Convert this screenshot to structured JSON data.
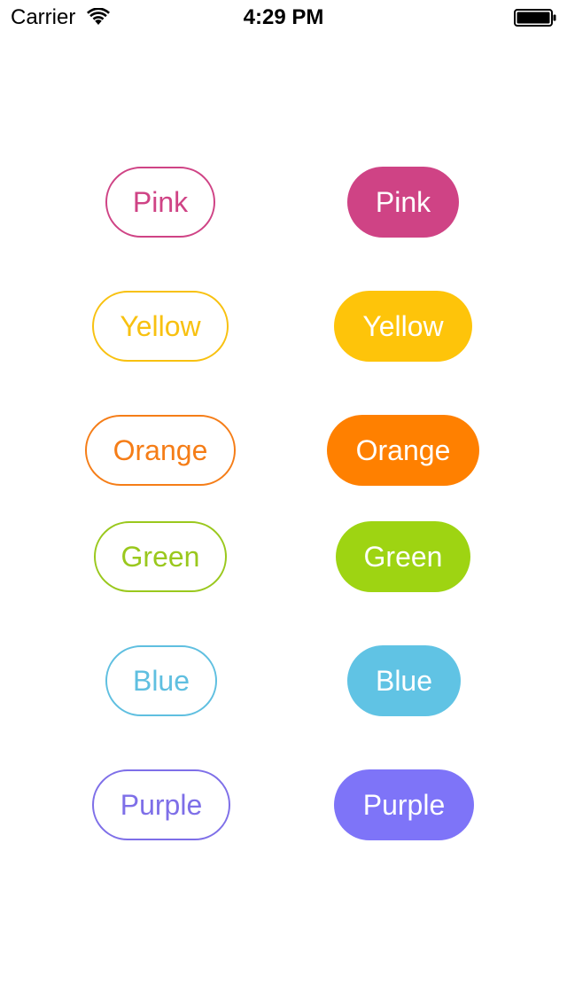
{
  "status_bar": {
    "carrier": "Carrier",
    "time": "4:29 PM",
    "wifi_icon": "wifi-icon",
    "battery_icon": "battery-icon"
  },
  "colors": {
    "pink": "#cf4385",
    "yellow": "#fec40a",
    "orange": "#ff8000",
    "green": "#9ed412",
    "blue": "#60c3e4",
    "purple": "#7e74f8"
  },
  "outline_buttons": [
    {
      "label": "Pink"
    },
    {
      "label": "Yellow"
    },
    {
      "label": "Orange"
    },
    {
      "label": "Green"
    },
    {
      "label": "Blue"
    },
    {
      "label": "Purple"
    }
  ],
  "filled_buttons": [
    {
      "label": "Pink"
    },
    {
      "label": "Yellow"
    },
    {
      "label": "Orange"
    },
    {
      "label": "Green"
    },
    {
      "label": "Blue"
    },
    {
      "label": "Purple"
    }
  ]
}
